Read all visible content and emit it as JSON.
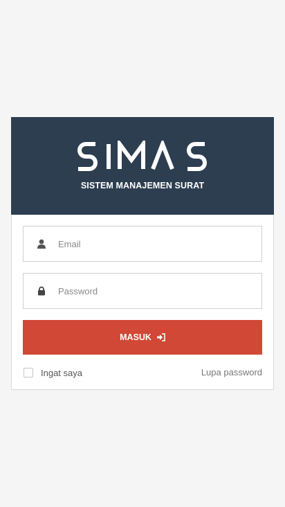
{
  "brand": {
    "logo_text": "SIMAS",
    "subtitle": "SISTEM MANAJEMEN SURAT",
    "header_color": "#2d3e50"
  },
  "form": {
    "email_placeholder": "Email",
    "password_placeholder": "Password",
    "email_icon": "user-icon",
    "password_icon": "lock-icon",
    "submit_label": "MASUK",
    "submit_icon": "sign-in-icon",
    "submit_color": "#d14836",
    "remember_label": "Ingat saya",
    "remember_checked": false,
    "forgot_label": "Lupa password"
  }
}
